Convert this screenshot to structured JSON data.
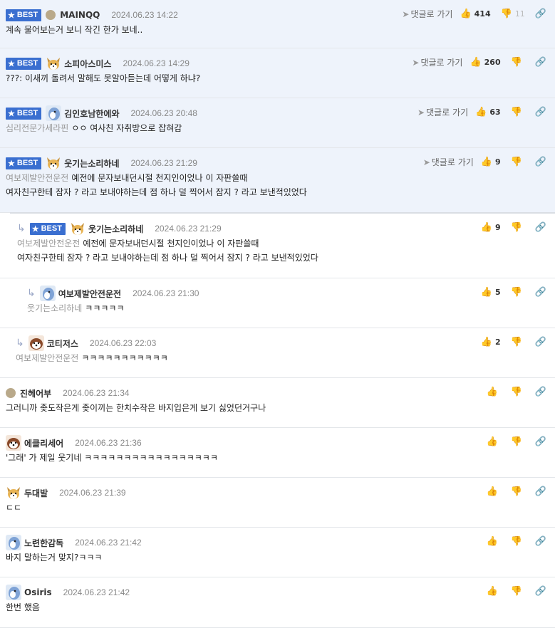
{
  "ui": {
    "best_label": "BEST",
    "goto_label": "댓글로 가기",
    "icons": {
      "star": "star-icon",
      "thumbs_up": "thumbs-up-icon",
      "thumbs_down": "thumbs-down-icon",
      "share": "link-icon",
      "reply_arrow": "reply-arrow-icon",
      "goto": "send-icon"
    },
    "colors": {
      "best_badge": "#3a6fd0",
      "best_bg": "#eef3fb",
      "tag_text": "#999999"
    }
  },
  "comments": [
    {
      "best": true,
      "avatar": "dot",
      "nick": "MAINQQ",
      "date": "2024.06.23 14:22",
      "tag": "",
      "text": "계속 물어보는거 보니 작긴 한가 보네..",
      "likes": "414",
      "dislikes": "11",
      "goto": true
    },
    {
      "best": true,
      "avatar": "fox",
      "nick": "소피아스미스",
      "date": "2024.06.23 14:29",
      "tag": "",
      "text": "???: 이새끼 돌려서 말해도 못알아듣는데 어떻게 하냐?",
      "likes": "260",
      "dislikes": "",
      "goto": true
    },
    {
      "best": true,
      "avatar": "bird",
      "nick": "김인호남한에와",
      "date": "2024.06.23 20:48",
      "tag": "심리전문가세라핀",
      "text": "ㅇㅇ 여사친 자취방으로 잡혀감",
      "likes": "63",
      "dislikes": "",
      "goto": true
    },
    {
      "best": true,
      "avatar": "fox",
      "nick": "웃기는소리하네",
      "date": "2024.06.23 21:29",
      "tag": "여보제발안전운전",
      "text": "예전에 문자보내던시절 천지인이었나 이 자판쓸때",
      "text2": "여자친구한테 잠자 ? 라고 보내야하는데 점 하나 덜 찍어서 잠지 ? 라고 보낸적있었다",
      "likes": "9",
      "dislikes": "",
      "goto": true
    },
    {
      "best": true,
      "reply": true,
      "avatar": "fox",
      "nick": "웃기는소리하네",
      "date": "2024.06.23 21:29",
      "tag": "여보제발안전운전",
      "text": "예전에 문자보내던시절 천지인이었나 이 자판쓸때",
      "text2": "여자친구한테 잠자 ? 라고 보내야하는데 점 하나 덜 찍어서 잠지 ? 라고 보낸적있었다",
      "likes": "9",
      "dislikes": ""
    },
    {
      "reply": true,
      "avatar": "bird",
      "nick": "여보제발안전운전",
      "date": "2024.06.23 21:30",
      "tag": "웃기는소리하네",
      "text": "ㅋㅋㅋㅋㅋ",
      "likes": "5",
      "dislikes": ""
    },
    {
      "reply": true,
      "avatar": "dog",
      "nick": "코티저스",
      "date": "2024.06.23 22:03",
      "tag": "여보제발안전운전",
      "text": "ㅋㅋㅋㅋㅋㅋㅋㅋㅋㅋㅋ",
      "likes": "2",
      "dislikes": ""
    },
    {
      "avatar": "dot",
      "nick": "진헤어부",
      "date": "2024.06.23 21:34",
      "tag": "",
      "text": "그러니까 좆도작은게 좆이끼는 한치수작은 바지입은게 보기 싫었던거구나",
      "likes": "",
      "dislikes": ""
    },
    {
      "avatar": "dog",
      "nick": "에클리세어",
      "date": "2024.06.23 21:36",
      "tag": "",
      "text": "'그래' 가 제일 웃기네 ㅋㅋㅋㅋㅋㅋㅋㅋㅋㅋㅋㅋㅋㅋㅋㅋㅋ",
      "likes": "",
      "dislikes": ""
    },
    {
      "avatar": "fox",
      "nick": "두대발",
      "date": "2024.06.23 21:39",
      "tag": "",
      "text": "ㄷㄷ",
      "likes": "",
      "dislikes": ""
    },
    {
      "avatar": "bird",
      "nick": "노련한감독",
      "date": "2024.06.23 21:42",
      "tag": "",
      "text": "바지 말하는거 맞지?ㅋㅋㅋ",
      "likes": "",
      "dislikes": ""
    },
    {
      "avatar": "bird",
      "nick": "Osiris",
      "date": "2024.06.23 21:42",
      "tag": "",
      "text": "한번 했음",
      "likes": "",
      "dislikes": ""
    }
  ]
}
